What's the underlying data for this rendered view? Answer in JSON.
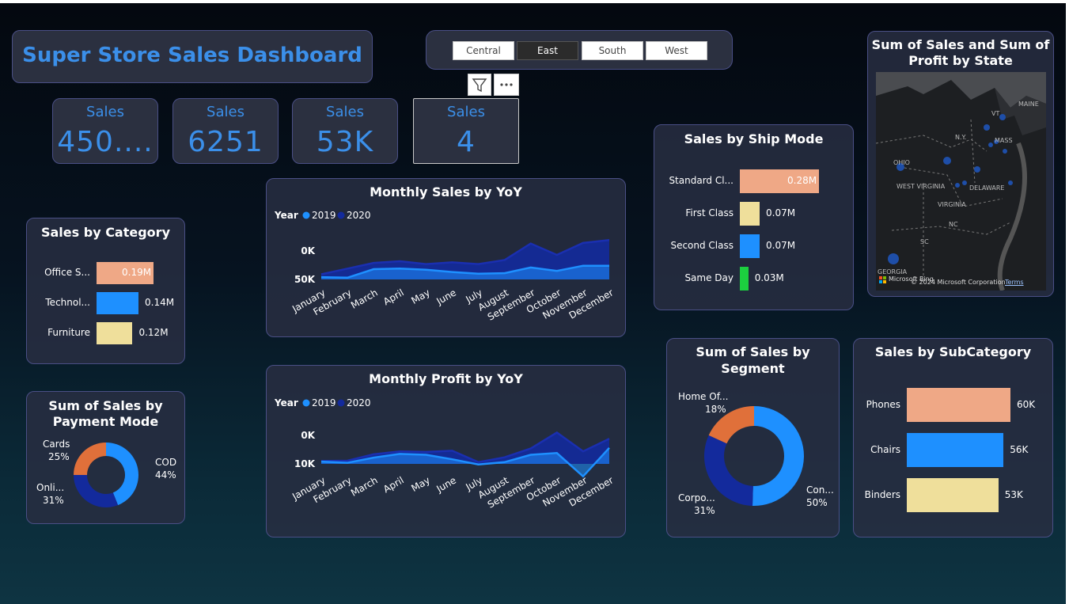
{
  "dashboard_title": "Super Store Sales Dashboard",
  "region_slicer": {
    "options": [
      "Central",
      "East",
      "South",
      "West"
    ],
    "selected": "East"
  },
  "visual_header": {
    "filter_icon": "filter-icon",
    "more_icon": "more-options-icon"
  },
  "kpis": [
    {
      "label": "Sales",
      "value": "450...."
    },
    {
      "label": "Sales",
      "value": "6251"
    },
    {
      "label": "Sales",
      "value": "53K"
    },
    {
      "label": "Sales",
      "value": "4"
    }
  ],
  "colors": {
    "accent": "#3b8fe9",
    "series_2019": "#1e90ff",
    "series_2020": "#132a9c",
    "peach": "#efa886",
    "blue": "#1e90ff",
    "yellow": "#efdf9b",
    "green": "#1ccf3f",
    "orange": "#e0703a"
  },
  "category": {
    "title": "Sales by Category",
    "items": [
      {
        "label": "Office S...",
        "value": 0.19,
        "value_label": "0.19M",
        "color": "#efa886"
      },
      {
        "label": "Technol...",
        "value": 0.14,
        "value_label": "0.14M",
        "color": "#1e90ff"
      },
      {
        "label": "Furniture",
        "value": 0.12,
        "value_label": "0.12M",
        "color": "#efdf9b"
      }
    ]
  },
  "payment": {
    "title": "Sum of Sales by Payment Mode",
    "title_lines": [
      "Sum of Sales by",
      "Payment Mode"
    ],
    "slices": [
      {
        "label": "COD",
        "pct": 44,
        "pct_label": "44%",
        "color": "#1e90ff"
      },
      {
        "label": "Onli...",
        "pct": 31,
        "pct_label": "31%",
        "color": "#132a9c"
      },
      {
        "label": "Cards",
        "pct": 25,
        "pct_label": "25%",
        "color": "#e0703a"
      }
    ]
  },
  "monthly_sales": {
    "title": "Monthly Sales by YoY",
    "legend_title": "Year",
    "series_names": [
      "2019",
      "2020"
    ],
    "months": [
      "January",
      "February",
      "March",
      "April",
      "May",
      "June",
      "July",
      "August",
      "September",
      "October",
      "November",
      "December"
    ],
    "y_ticks": [
      "50K",
      "0K"
    ]
  },
  "monthly_profit": {
    "title": "Monthly Profit by YoY",
    "legend_title": "Year",
    "series_names": [
      "2019",
      "2020"
    ],
    "months": [
      "January",
      "February",
      "March",
      "April",
      "May",
      "June",
      "July",
      "August",
      "September",
      "October",
      "November",
      "December"
    ],
    "y_ticks": [
      "10K",
      "0K"
    ]
  },
  "ship_mode": {
    "title": "Sales by Ship Mode",
    "items": [
      {
        "label": "Standard Cl...",
        "value": 0.28,
        "value_label": "0.28M",
        "color": "#efa886"
      },
      {
        "label": "First Class",
        "value": 0.07,
        "value_label": "0.07M",
        "color": "#efdf9b"
      },
      {
        "label": "Second Class",
        "value": 0.07,
        "value_label": "0.07M",
        "color": "#1e90ff"
      },
      {
        "label": "Same Day",
        "value": 0.03,
        "value_label": "0.03M",
        "color": "#1ccf3f"
      }
    ]
  },
  "segment": {
    "title": "Sum of Sales by Segment",
    "title_lines": [
      "Sum of Sales by",
      "Segment"
    ],
    "slices": [
      {
        "label": "Con...",
        "pct": 50,
        "pct_label": "50%",
        "color": "#1e90ff"
      },
      {
        "label": "Corpo...",
        "pct": 31,
        "pct_label": "31%",
        "color": "#132a9c"
      },
      {
        "label": "Home Of...",
        "pct": 18,
        "pct_label": "18%",
        "color": "#e0703a"
      }
    ]
  },
  "subcategory": {
    "title": "Sales by SubCategory",
    "items": [
      {
        "label": "Phones",
        "value": 60,
        "value_label": "60K",
        "color": "#efa886"
      },
      {
        "label": "Chairs",
        "value": 56,
        "value_label": "56K",
        "color": "#1e90ff"
      },
      {
        "label": "Binders",
        "value": 53,
        "value_label": "53K",
        "color": "#efdf9b"
      }
    ]
  },
  "map": {
    "title": "Sum of Sales and Sum of Profit by State",
    "title_lines": [
      "Sum of Sales and Sum of",
      "Profit by State"
    ],
    "labels": [
      "MAINE",
      "VT",
      "N.Y.",
      "MASS",
      "OHIO",
      "WEST VIRGINIA",
      "DELAWARE",
      "VIRGINIA",
      "NC",
      "SC",
      "GEORGIA"
    ],
    "attribution": "© 2024 Microsoft Corporation",
    "terms": "Terms",
    "logo_text": "Microsoft Bing"
  },
  "chart_data": [
    {
      "type": "area",
      "title": "Monthly Sales by YoY",
      "x": [
        "January",
        "February",
        "March",
        "April",
        "May",
        "June",
        "July",
        "August",
        "September",
        "October",
        "November",
        "December"
      ],
      "ylim": [
        0,
        65000
      ],
      "y_ticks": [
        0,
        50000
      ],
      "series": [
        {
          "name": "2019",
          "values": [
            4000,
            3000,
            18000,
            19000,
            17000,
            13000,
            10000,
            11000,
            21000,
            15000,
            24000,
            24000
          ]
        },
        {
          "name": "2020",
          "values": [
            9000,
            19000,
            29000,
            32000,
            27000,
            30000,
            27000,
            34000,
            63000,
            43000,
            64000,
            69000
          ]
        }
      ],
      "legend": "top-left",
      "grid": false
    },
    {
      "type": "area",
      "title": "Monthly Profit by YoY",
      "x": [
        "January",
        "February",
        "March",
        "April",
        "May",
        "June",
        "July",
        "August",
        "September",
        "October",
        "November",
        "December"
      ],
      "ylim": [
        -5000,
        11000
      ],
      "y_ticks": [
        0,
        10000
      ],
      "series": [
        {
          "name": "2019",
          "values": [
            800,
            400,
            2200,
            3500,
            3200,
            1600,
            -200,
            600,
            3200,
            3800,
            -4400,
            5600
          ]
        },
        {
          "name": "2020",
          "values": [
            1000,
            1100,
            3400,
            4400,
            4200,
            4600,
            600,
            2300,
            5400,
            11000,
            4400,
            8800
          ]
        }
      ],
      "legend": "top-left",
      "grid": false
    },
    {
      "type": "bar",
      "title": "Sales by Category",
      "categories": [
        "Office S...",
        "Technol...",
        "Furniture"
      ],
      "values": [
        0.19,
        0.14,
        0.12
      ]
    },
    {
      "type": "bar",
      "title": "Sales by Ship Mode",
      "categories": [
        "Standard Cl...",
        "First Class",
        "Second Class",
        "Same Day"
      ],
      "values": [
        0.28,
        0.07,
        0.07,
        0.03
      ]
    },
    {
      "type": "bar",
      "title": "Sales by SubCategory",
      "categories": [
        "Phones",
        "Chairs",
        "Binders"
      ],
      "values": [
        60,
        56,
        53
      ]
    },
    {
      "type": "pie",
      "title": "Sum of Sales by Payment Mode",
      "categories": [
        "COD",
        "Onli...",
        "Cards"
      ],
      "values": [
        44,
        31,
        25
      ]
    },
    {
      "type": "pie",
      "title": "Sum of Sales by Segment",
      "categories": [
        "Con...",
        "Corpo...",
        "Home Of..."
      ],
      "values": [
        50,
        31,
        18
      ]
    }
  ]
}
